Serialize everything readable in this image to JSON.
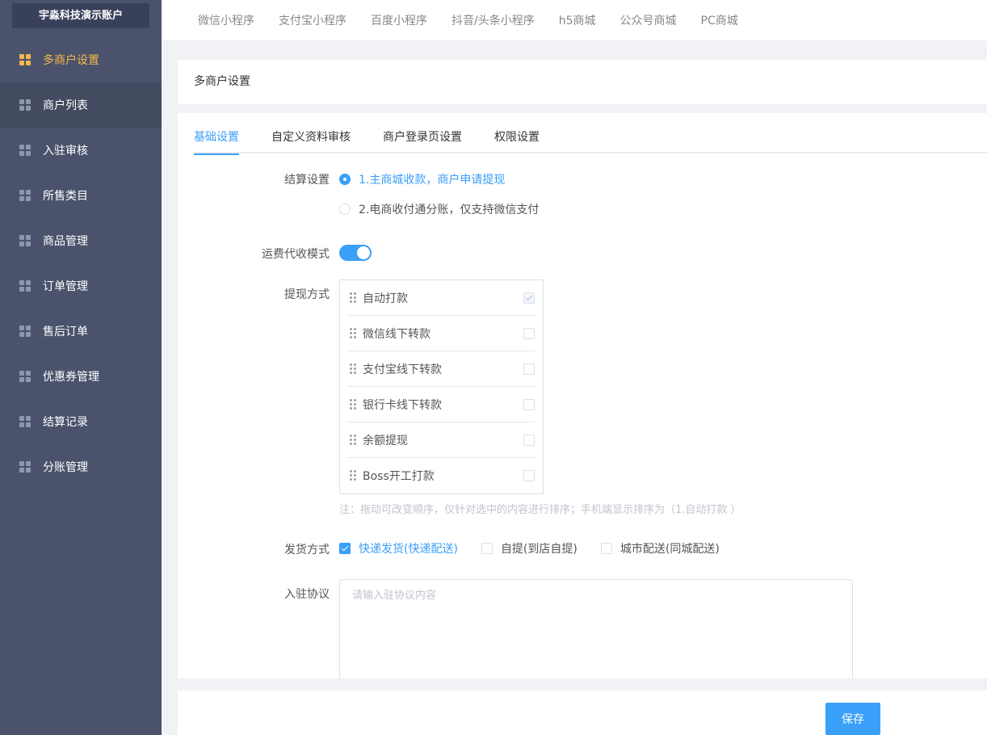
{
  "sidebar": {
    "account": "宇淼科技演示账户",
    "items": [
      {
        "label": "多商户设置",
        "icon": "grid-icon"
      },
      {
        "label": "商户列表",
        "icon": "grid-icon"
      },
      {
        "label": "入驻审核",
        "icon": "grid-icon"
      },
      {
        "label": "所售类目",
        "icon": "grid-icon"
      },
      {
        "label": "商品管理",
        "icon": "grid-icon"
      },
      {
        "label": "订单管理",
        "icon": "grid-icon"
      },
      {
        "label": "售后订单",
        "icon": "grid-icon"
      },
      {
        "label": "优惠券管理",
        "icon": "grid-icon"
      },
      {
        "label": "结算记录",
        "icon": "grid-icon"
      },
      {
        "label": "分账管理",
        "icon": "grid-icon"
      }
    ]
  },
  "topbar": {
    "tabs": [
      "微信小程序",
      "支付宝小程序",
      "百度小程序",
      "抖音/头条小程序",
      "h5商城",
      "公众号商城",
      "PC商城"
    ]
  },
  "header": {
    "title": "多商户设置"
  },
  "tabs": [
    "基础设置",
    "自定义资料审核",
    "商户登录页设置",
    "权限设置"
  ],
  "settlement": {
    "label": "结算设置",
    "options": [
      "1.主商城收款，商户申请提现",
      "2.电商收付通分账，仅支持微信支付"
    ]
  },
  "freight": {
    "label": "运费代收模式",
    "enabled": true
  },
  "withdraw": {
    "label": "提现方式",
    "items": [
      "自动打款",
      "微信线下转款",
      "支付宝线下转款",
      "银行卡线下转款",
      "余额提现",
      "Boss开工打款"
    ],
    "note": "注：拖动可改变顺序，仅针对选中的内容进行排序；手机端显示排序为（1.自动打款 ）"
  },
  "shipping": {
    "label": "发货方式",
    "options": [
      "快递发货(快递配送)",
      "自提(到店自提)",
      "城市配送(同城配送)"
    ]
  },
  "agreement": {
    "label": "入驻协议",
    "placeholder": "请输入驻协议内容"
  },
  "footer": {
    "save_label": "保存"
  },
  "colors": {
    "accent": "#3a9ff8",
    "sidebar": "#4a536b",
    "active_nav": "#f7b84b"
  }
}
